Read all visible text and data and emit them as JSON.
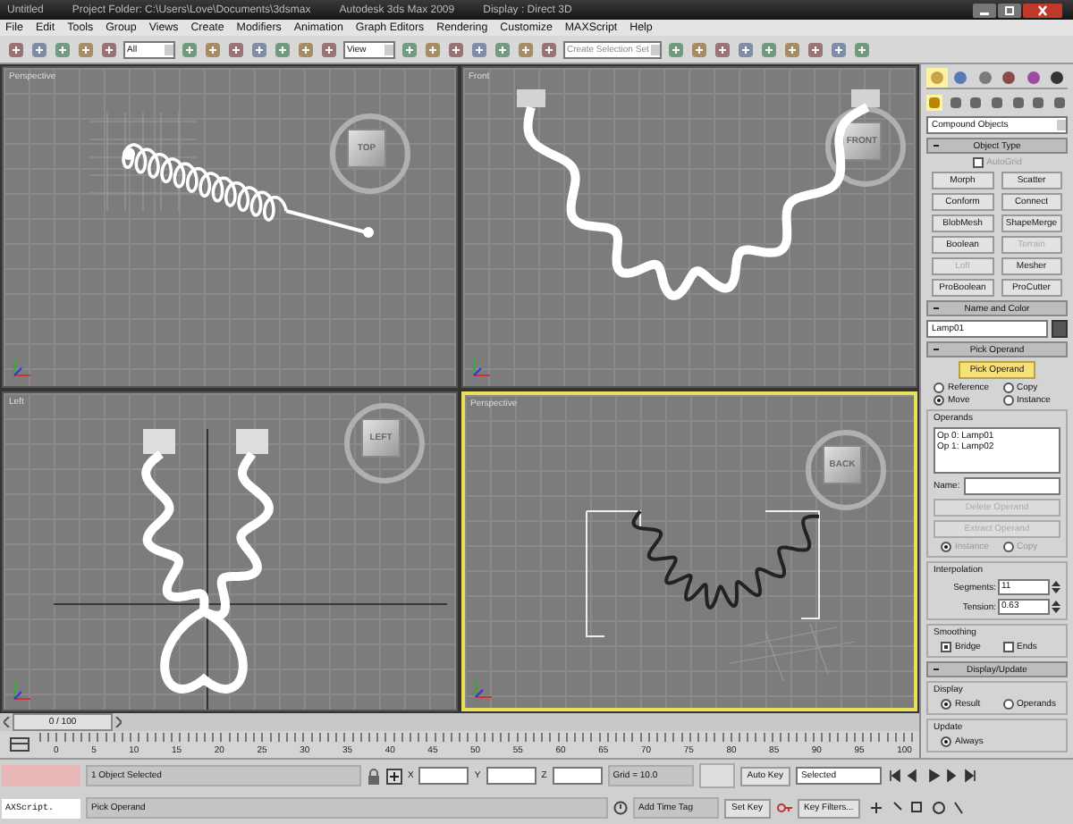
{
  "window": {
    "title_parts": [
      "Untitled",
      "Project Folder: C:\\Users\\Love\\Documents\\3dsmax",
      "Autodesk 3ds Max 2009",
      "Display : Direct 3D"
    ]
  },
  "menu": [
    "File",
    "Edit",
    "Tools",
    "Group",
    "Views",
    "Create",
    "Modifiers",
    "Animation",
    "Graph Editors",
    "Rendering",
    "Customize",
    "MAXScript",
    "Help"
  ],
  "toolbar": {
    "selection_filter": "All",
    "reference_coordinate": "View",
    "named_selection": "Create Selection Set"
  },
  "viewports": [
    {
      "label": "Perspective",
      "cube": "TOP",
      "active": false
    },
    {
      "label": "Front",
      "cube": "FRONT",
      "active": false
    },
    {
      "label": "Left",
      "cube": "LEFT",
      "active": false
    },
    {
      "label": "Perspective",
      "cube": "BACK",
      "active": true
    }
  ],
  "command_panel": {
    "category": "Compound Objects",
    "object_type": {
      "title": "Object Type",
      "autogrid": {
        "label": "AutoGrid",
        "checked": false,
        "disabled": true
      },
      "buttons": [
        {
          "label": "Morph",
          "disabled": false
        },
        {
          "label": "Scatter",
          "disabled": false
        },
        {
          "label": "Conform",
          "disabled": false
        },
        {
          "label": "Connect",
          "disabled": false
        },
        {
          "label": "BlobMesh",
          "disabled": false
        },
        {
          "label": "ShapeMerge",
          "disabled": false
        },
        {
          "label": "Boolean",
          "disabled": false
        },
        {
          "label": "Terrain",
          "disabled": true
        },
        {
          "label": "Loft",
          "disabled": true
        },
        {
          "label": "Mesher",
          "disabled": false
        },
        {
          "label": "ProBoolean",
          "disabled": false
        },
        {
          "label": "ProCutter",
          "disabled": false
        }
      ]
    },
    "name_and_color": {
      "title": "Name and Color",
      "name": "Lamp01"
    },
    "pick_operand": {
      "title": "Pick Operand",
      "button": {
        "label": "Pick Operand",
        "selected": true
      },
      "options": [
        {
          "label": "Reference",
          "selected": false
        },
        {
          "label": "Copy",
          "selected": false
        },
        {
          "label": "Move",
          "selected": true
        },
        {
          "label": "Instance",
          "selected": false
        }
      ]
    },
    "operands": {
      "title": "Operands",
      "items": [
        "Op 0: Lamp01",
        "Op 1: Lamp02"
      ],
      "name_label": "Name:",
      "buttons": [
        {
          "label": "Delete Operand",
          "disabled": true
        },
        {
          "label": "Extract Operand",
          "disabled": true
        }
      ],
      "options": [
        {
          "label": "Instance",
          "selected": true,
          "disabled": true
        },
        {
          "label": "Copy",
          "selected": false,
          "disabled": true
        }
      ]
    },
    "interpolation": {
      "title": "Interpolation",
      "fields": [
        {
          "label": "Segments:",
          "value": "11"
        },
        {
          "label": "Tension:",
          "value": "0.63"
        }
      ]
    },
    "smoothing": {
      "title": "Smoothing",
      "checks": [
        {
          "label": "Bridge",
          "checked": true
        },
        {
          "label": "Ends",
          "checked": false
        }
      ]
    },
    "display_update": {
      "title": "Display/Update",
      "display": {
        "title": "Display",
        "options": [
          {
            "label": "Result",
            "selected": true
          },
          {
            "label": "Operands",
            "selected": false
          }
        ]
      },
      "update": {
        "title": "Update",
        "options": [
          {
            "label": "Always",
            "selected": true
          }
        ]
      }
    }
  },
  "timeline": {
    "frame": "0 / 100",
    "ticks": [
      "0",
      "5",
      "10",
      "15",
      "20",
      "25",
      "30",
      "35",
      "40",
      "45",
      "50",
      "55",
      "60",
      "65",
      "70",
      "75",
      "80",
      "85",
      "90",
      "95",
      "100"
    ]
  },
  "status": {
    "selection": "1 Object Selected",
    "prompt": "Pick Operand",
    "listener": "AXScript.",
    "coords": [
      "X",
      "Y",
      "Z"
    ],
    "grid": "Grid = 10.0",
    "time_tag": "Add Time Tag",
    "auto_key": "Auto Key",
    "key_mode": "Selected",
    "set_key": "Set Key",
    "key_filters": "Key Filters..."
  }
}
